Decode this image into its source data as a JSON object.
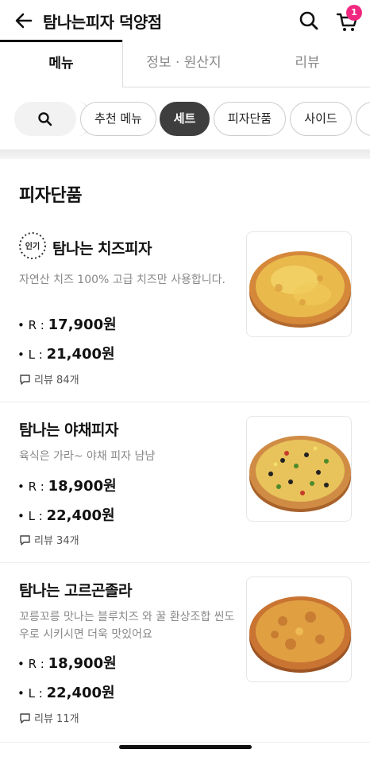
{
  "header": {
    "title": "탐나는피자 덕양점",
    "cart_count": "1"
  },
  "tabs": [
    {
      "label": "메뉴"
    },
    {
      "label": "정보 · 원산지"
    },
    {
      "label": "리뷰"
    }
  ],
  "chips": [
    {
      "label": "추천 메뉴"
    },
    {
      "label": "세트"
    },
    {
      "label": "피자단품"
    },
    {
      "label": "사이드"
    }
  ],
  "section_title": "피자단품",
  "items": [
    {
      "name": "탐나는 치즈피자",
      "badge": "인기",
      "desc": "자연산 치즈 100%  고급 치즈만 사용합니다.",
      "price_r_label": "• R : ",
      "price_r": "17,900원",
      "price_l_label": "• L : ",
      "price_l": "21,400원",
      "review": "리뷰 84개"
    },
    {
      "name": "탐나는 야채피자",
      "desc": "육식은 가라~ 야채 피자 냠냠",
      "price_r_label": "• R : ",
      "price_r": "18,900원",
      "price_l_label": "• L : ",
      "price_l": "22,400원",
      "review": "리뷰 34개"
    },
    {
      "name": "탐나는 고르곤졸라",
      "desc": "꼬릉꼬릉 맛나는 블루치즈 와 꿀 환상조합 씬도우로 시키시면 더욱 맛있어요",
      "price_r_label": "• R : ",
      "price_r": "18,900원",
      "price_l_label": "• L : ",
      "price_l": "22,400원",
      "review": "리뷰 11개"
    }
  ],
  "colors": {
    "badge_pink": "#f0287f",
    "chip_active": "#3e3e3e"
  },
  "icons": [
    "back-arrow-icon",
    "search-icon",
    "cart-icon",
    "comment-icon",
    "popular-badge-icon"
  ]
}
